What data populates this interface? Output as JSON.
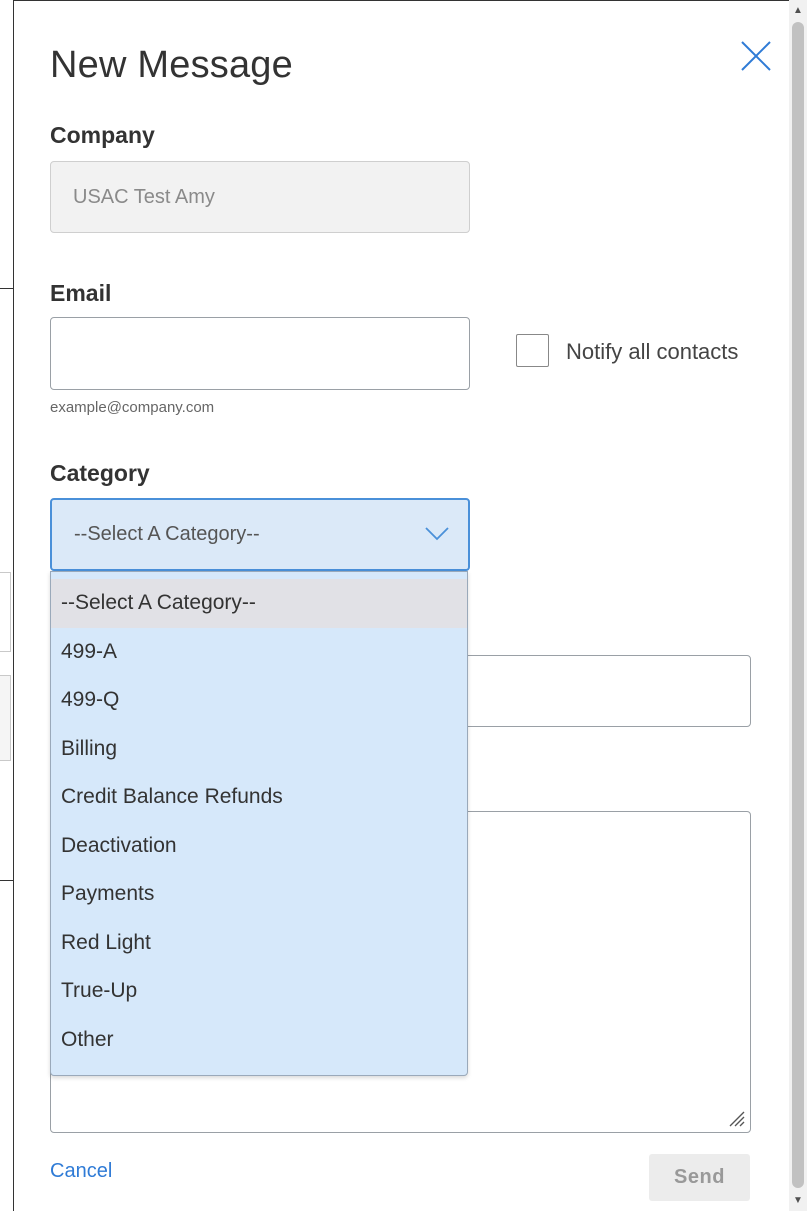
{
  "modal": {
    "title": "New Message",
    "close_icon": "close-icon"
  },
  "company": {
    "label": "Company",
    "value": "USAC Test Amy"
  },
  "email": {
    "label": "Email",
    "value": "",
    "helper": "example@company.com",
    "notify_label": "Notify all contacts",
    "notify_checked": false
  },
  "category": {
    "label": "Category",
    "selected": "--Select A Category--",
    "options": [
      "--Select A Category--",
      "499-A",
      "499-Q",
      "Billing",
      "Credit Balance Refunds",
      "Deactivation",
      "Payments",
      "Red Light",
      "True-Up",
      "Other"
    ]
  },
  "footer": {
    "cancel_label": "Cancel",
    "send_label": "Send"
  },
  "colors": {
    "accent": "#2f7bd6",
    "select_focus_border": "#4a90d9",
    "dropdown_bg": "#d6e8fa",
    "highlight_option": "#e1e1e6"
  }
}
